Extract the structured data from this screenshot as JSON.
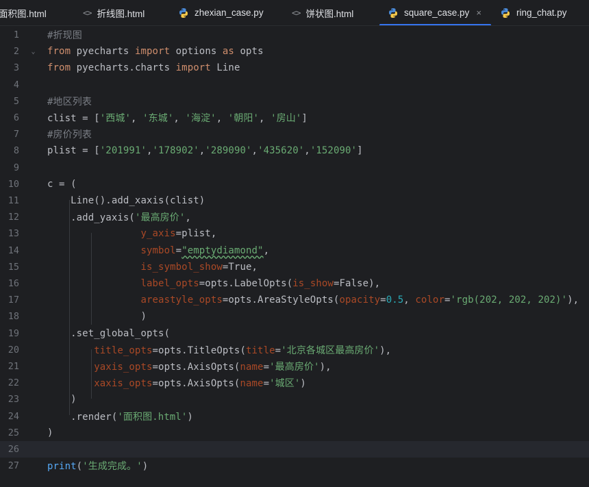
{
  "tabs": [
    {
      "icon": "html-icon",
      "label": "面积图.html",
      "active": false,
      "display": "面积图.html"
    },
    {
      "icon": "html-icon",
      "label": "折线图.html",
      "active": false
    },
    {
      "icon": "python-icon",
      "label": "zhexian_case.py",
      "active": false
    },
    {
      "icon": "html-icon",
      "label": "饼状图.html",
      "active": false
    },
    {
      "icon": "python-icon",
      "label": "square_case.py",
      "active": true,
      "close": "×"
    },
    {
      "icon": "python-icon",
      "label": "ring_chat.py",
      "active": false
    }
  ],
  "editor": {
    "current_line": 26,
    "line_numbers": [
      "1",
      "2",
      "3",
      "4",
      "5",
      "6",
      "7",
      "8",
      "9",
      "10",
      "11",
      "12",
      "13",
      "14",
      "15",
      "16",
      "17",
      "18",
      "19",
      "20",
      "21",
      "22",
      "23",
      "24",
      "25",
      "26",
      "27"
    ],
    "fold_marker": "⌄",
    "lines": [
      [
        {
          "t": "#折现图",
          "c": "c"
        }
      ],
      [
        {
          "t": "from",
          "c": "k"
        },
        {
          "t": " pyecharts "
        },
        {
          "t": "import",
          "c": "k"
        },
        {
          "t": " options "
        },
        {
          "t": "as",
          "c": "k"
        },
        {
          "t": " opts"
        }
      ],
      [
        {
          "t": "from",
          "c": "k"
        },
        {
          "t": " pyecharts.charts "
        },
        {
          "t": "import",
          "c": "k"
        },
        {
          "t": " Line"
        }
      ],
      [],
      [
        {
          "t": "#地区列表",
          "c": "c"
        }
      ],
      [
        {
          "t": "clist = ["
        },
        {
          "t": "'西城'",
          "c": "s"
        },
        {
          "t": ", "
        },
        {
          "t": "'东城'",
          "c": "s"
        },
        {
          "t": ", "
        },
        {
          "t": "'海淀'",
          "c": "s"
        },
        {
          "t": ", "
        },
        {
          "t": "'朝阳'",
          "c": "s"
        },
        {
          "t": ", "
        },
        {
          "t": "'房山'",
          "c": "s"
        },
        {
          "t": "]"
        }
      ],
      [
        {
          "t": "#房价列表",
          "c": "c"
        }
      ],
      [
        {
          "t": "plist = ["
        },
        {
          "t": "'201991'",
          "c": "s"
        },
        {
          "t": ","
        },
        {
          "t": "'178902'",
          "c": "s"
        },
        {
          "t": ","
        },
        {
          "t": "'289090'",
          "c": "s"
        },
        {
          "t": ","
        },
        {
          "t": "'435620'",
          "c": "s"
        },
        {
          "t": ","
        },
        {
          "t": "'152090'",
          "c": "s"
        },
        {
          "t": "]"
        }
      ],
      [],
      [
        {
          "t": "c = ("
        }
      ],
      [
        {
          "t": "    Line().add_xaxis(clist)"
        }
      ],
      [
        {
          "t": "    .add_yaxis("
        },
        {
          "t": "'最高房价'",
          "c": "s"
        },
        {
          "t": ","
        }
      ],
      [
        {
          "t": "                "
        },
        {
          "t": "y_axis",
          "c": "p"
        },
        {
          "t": "=plist,"
        }
      ],
      [
        {
          "t": "                "
        },
        {
          "t": "symbol",
          "c": "p"
        },
        {
          "t": "="
        },
        {
          "t": "\"emptydiamond\"",
          "c": "s w"
        },
        {
          "t": ","
        }
      ],
      [
        {
          "t": "                "
        },
        {
          "t": "is_symbol_show",
          "c": "p"
        },
        {
          "t": "=True,"
        }
      ],
      [
        {
          "t": "                "
        },
        {
          "t": "label_opts",
          "c": "p"
        },
        {
          "t": "=opts.LabelOpts("
        },
        {
          "t": "is_show",
          "c": "p"
        },
        {
          "t": "=False),"
        }
      ],
      [
        {
          "t": "                "
        },
        {
          "t": "areastyle_opts",
          "c": "p"
        },
        {
          "t": "=opts.AreaStyleOpts("
        },
        {
          "t": "opacity",
          "c": "p"
        },
        {
          "t": "="
        },
        {
          "t": "0.5",
          "c": "n"
        },
        {
          "t": ", "
        },
        {
          "t": "color",
          "c": "p"
        },
        {
          "t": "="
        },
        {
          "t": "'rgb(202, 202, 202)'",
          "c": "s"
        },
        {
          "t": "),"
        }
      ],
      [
        {
          "t": "                )"
        }
      ],
      [
        {
          "t": "    .set_global_opts("
        }
      ],
      [
        {
          "t": "        "
        },
        {
          "t": "title_opts",
          "c": "p"
        },
        {
          "t": "=opts.TitleOpts("
        },
        {
          "t": "title",
          "c": "p"
        },
        {
          "t": "="
        },
        {
          "t": "'北京各城区最高房价'",
          "c": "s"
        },
        {
          "t": "),"
        }
      ],
      [
        {
          "t": "        "
        },
        {
          "t": "yaxis_opts",
          "c": "p"
        },
        {
          "t": "=opts.AxisOpts("
        },
        {
          "t": "name",
          "c": "p"
        },
        {
          "t": "="
        },
        {
          "t": "'最高房价'",
          "c": "s"
        },
        {
          "t": "),"
        }
      ],
      [
        {
          "t": "        "
        },
        {
          "t": "xaxis_opts",
          "c": "p"
        },
        {
          "t": "=opts.AxisOpts("
        },
        {
          "t": "name",
          "c": "p"
        },
        {
          "t": "="
        },
        {
          "t": "'城区'",
          "c": "s"
        },
        {
          "t": ")"
        }
      ],
      [
        {
          "t": "    )"
        }
      ],
      [
        {
          "t": "    .render("
        },
        {
          "t": "'面积图.html'",
          "c": "s"
        },
        {
          "t": ")"
        }
      ],
      [
        {
          "t": ")"
        }
      ],
      [],
      [
        {
          "t": "print",
          "c": "f"
        },
        {
          "t": "("
        },
        {
          "t": "'生成完成。'",
          "c": "s"
        },
        {
          "t": ")"
        }
      ]
    ]
  }
}
